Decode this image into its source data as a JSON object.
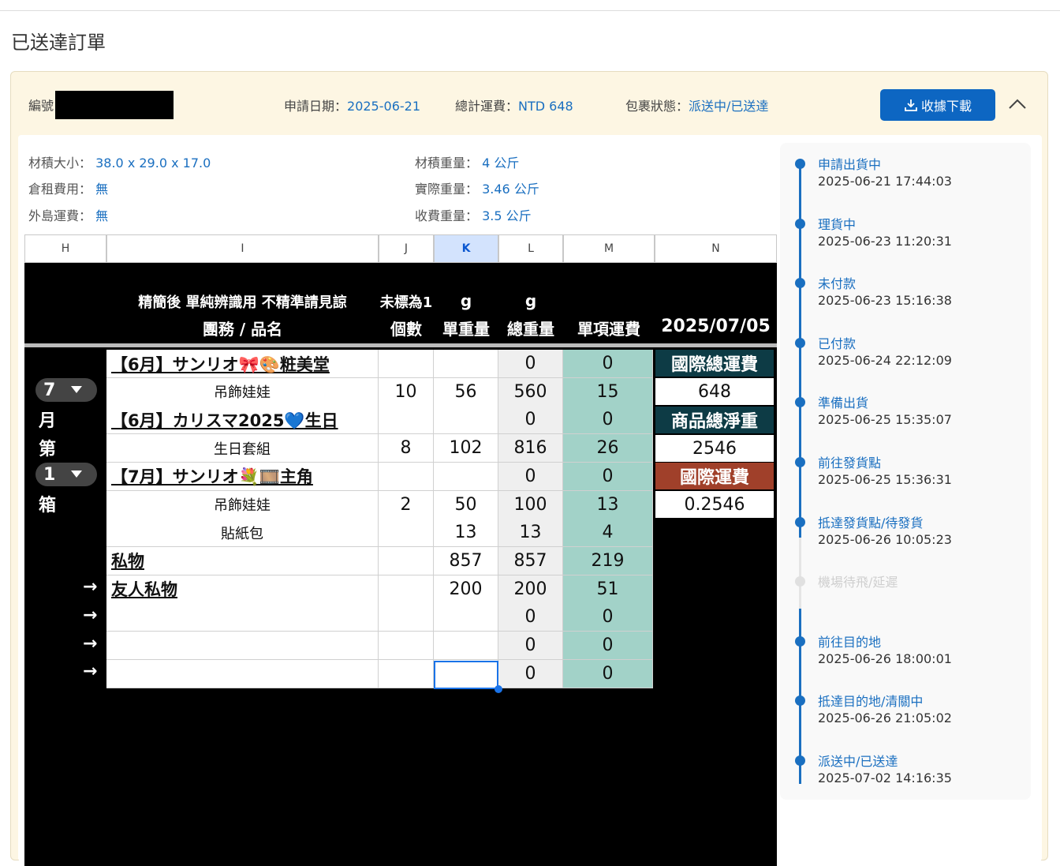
{
  "page_title": "已送達訂單",
  "order": {
    "id_label": "編號",
    "date_label": "申請日期：",
    "date_value": "2025-06-21",
    "fee_label": "總計運費：",
    "fee_value": "NTD 648",
    "status_label": "包裹狀態：",
    "status_value": "派送中/已送達",
    "download_label": "收據下載"
  },
  "info": {
    "size_label": "材積大小：",
    "size_value": "38.0 x 29.0 x 17.0",
    "storage_label": "倉租費用：",
    "storage_value": "無",
    "island_label": "外島運費：",
    "island_value": "無",
    "vol_weight_label": "材積重量：",
    "vol_weight_value": "4 公斤",
    "actual_weight_label": "實際重量：",
    "actual_weight_value": "3.46 公斤",
    "charge_weight_label": "收費重量：",
    "charge_weight_value": "3.5 公斤"
  },
  "sheet": {
    "columns": [
      "H",
      "I",
      "J",
      "K",
      "L",
      "M",
      "N"
    ],
    "header_note": "精簡後 單純辨識用 不精準請見諒",
    "header_unmarked": "未標為1",
    "header_g1": "g",
    "header_g2": "g",
    "h_group": "團務 / 品名",
    "h_count": "個數",
    "h_unit": "單重量",
    "h_total": "總重量",
    "h_fee": "單項運費",
    "h_date": "2025/07/05",
    "left": {
      "month_num": "7",
      "month": "月",
      "di": "第",
      "box_num": "1",
      "box": "箱"
    },
    "arrow": "→",
    "rows": [
      {
        "name": "【6月】サンリオ🎀🎨粧美堂",
        "count": "",
        "unit": "",
        "total": "0",
        "fee": "0"
      },
      {
        "item": "吊飾娃娃",
        "count": "10",
        "unit": "56",
        "total": "560",
        "fee": "15"
      },
      {
        "name": "【6月】カリスマ2025💙生日",
        "count": "",
        "unit": "",
        "total": "0",
        "fee": "0"
      },
      {
        "item": "生日套組",
        "count": "8",
        "unit": "102",
        "total": "816",
        "fee": "26"
      },
      {
        "name": "【7月】サンリオ💐🎞️主角",
        "count": "",
        "unit": "",
        "total": "0",
        "fee": "0"
      },
      {
        "item": "吊飾娃娃",
        "count": "2",
        "unit": "50",
        "total": "100",
        "fee": "13"
      },
      {
        "item": "貼紙包",
        "count": "",
        "unit": "13",
        "total": "13",
        "fee": "4"
      },
      {
        "name": "私物",
        "count": "",
        "unit": "857",
        "total": "857",
        "fee": "219"
      },
      {
        "name": "友人私物",
        "count": "",
        "unit": "200",
        "total": "200",
        "fee": "51"
      },
      {
        "item": "",
        "count": "",
        "unit": "",
        "total": "0",
        "fee": "0"
      },
      {
        "item": "",
        "count": "",
        "unit": "",
        "total": "0",
        "fee": "0"
      },
      {
        "item": "",
        "count": "",
        "unit": "",
        "total": "0",
        "fee": "0"
      }
    ],
    "summary": {
      "intl_total_label": "國際總運費",
      "intl_total_value": "648",
      "net_weight_label": "商品總淨重",
      "net_weight_value": "2546",
      "intl_fee_label": "國際運費",
      "intl_fee_value": "0.2546"
    }
  },
  "timeline": [
    {
      "status": "申請出貨中",
      "time": "2025-06-21 17:44:03",
      "active": true
    },
    {
      "status": "理貨中",
      "time": "2025-06-23 11:20:31",
      "active": true
    },
    {
      "status": "未付款",
      "time": "2025-06-23 15:16:38",
      "active": true
    },
    {
      "status": "已付款",
      "time": "2025-06-24 22:12:09",
      "active": true
    },
    {
      "status": "準備出貨",
      "time": "2025-06-25 15:35:07",
      "active": true
    },
    {
      "status": "前往發貨點",
      "time": "2025-06-25 15:36:31",
      "active": true
    },
    {
      "status": "抵達發貨點/待發貨",
      "time": "2025-06-26 10:05:23",
      "active": true
    },
    {
      "status": "機場待飛/延遲",
      "time": "",
      "active": false
    },
    {
      "status": "前往目的地",
      "time": "2025-06-26 18:00:01",
      "active": true
    },
    {
      "status": "抵達目的地/清關中",
      "time": "2025-06-26 21:05:02",
      "active": true
    },
    {
      "status": "派送中/已送達",
      "time": "2025-07-02 14:16:35",
      "active": true
    }
  ],
  "colors": {
    "accent": "#1a6fc0",
    "button": "#0d66c2",
    "card_bg": "#fdf6e3",
    "teal": "#a2d2c8",
    "dark_teal": "#0d3b45",
    "rust": "#a0402a"
  }
}
